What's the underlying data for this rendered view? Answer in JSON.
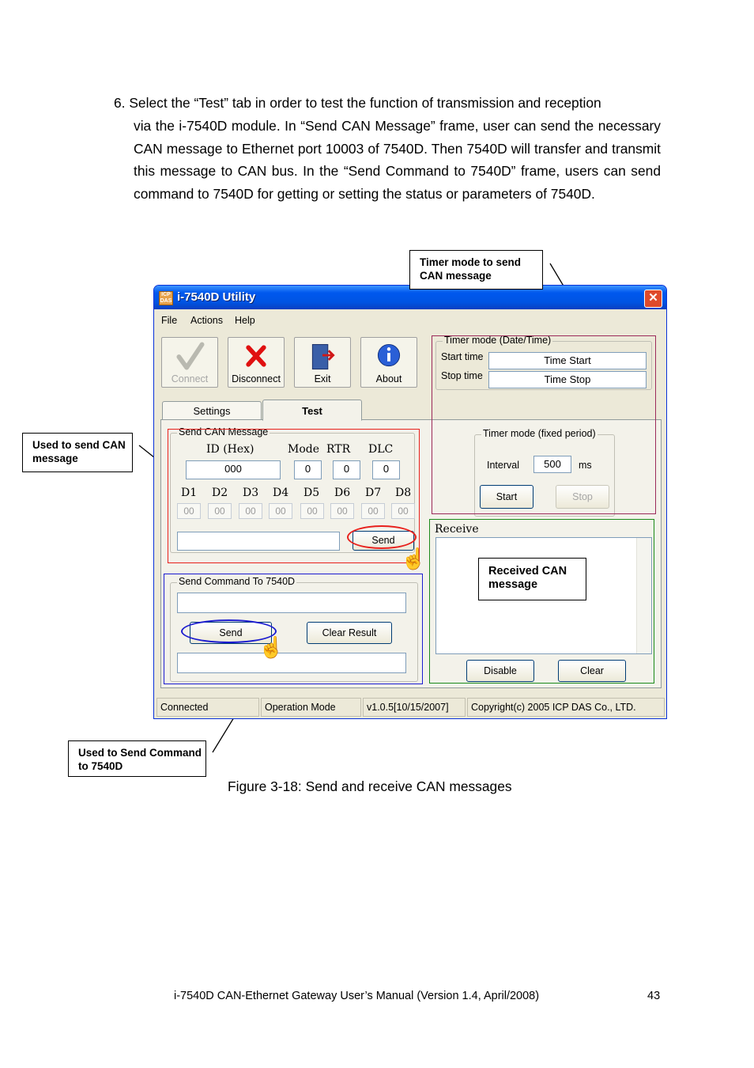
{
  "paragraph": {
    "first_line": "6. Select the “Test” tab in order to test the function of transmission and reception",
    "rest": "via the i-7540D module. In “Send CAN Message” frame, user can send the necessary CAN message to Ethernet port 10003 of 7540D. Then 7540D will transfer and transmit this message to CAN bus. In the “Send Command to 7540D” frame, users can send command to 7540D for getting or setting the status or parameters of 7540D."
  },
  "callouts": {
    "timer_mode": "Timer mode to send CAN message",
    "send_can": "Used to send CAN message",
    "received": "Received CAN message",
    "send_command": "Used to Send Command to 7540D"
  },
  "window": {
    "title": "i-7540D Utility",
    "icon_text": "ICP DAS",
    "close_glyph": "✕",
    "menu": [
      "File",
      "Actions",
      "Help"
    ],
    "toolbar": {
      "connect": "Connect",
      "disconnect": "Disconnect",
      "exit": "Exit",
      "about": "About"
    },
    "timer_datetime": {
      "label": "Timer mode  (Date/Time)",
      "start_label": "Start time",
      "start_value": "Time Start",
      "stop_label": "Stop time",
      "stop_value": "Time Stop"
    },
    "tabs": {
      "settings": "Settings",
      "test": "Test"
    },
    "send_can": {
      "label": "Send CAN Message",
      "id_label": "ID (Hex)",
      "mode_label": "Mode",
      "rtr_label": "RTR",
      "dlc_label": "DLC",
      "id_value": "000",
      "mode_value": "0",
      "rtr_value": "0",
      "dlc_value": "0",
      "data_labels": [
        "D1",
        "D2",
        "D3",
        "D4",
        "D5",
        "D6",
        "D7",
        "D8"
      ],
      "data_values": [
        "00",
        "00",
        "00",
        "00",
        "00",
        "00",
        "00",
        "00"
      ],
      "send_label": "Send"
    },
    "timer_fixed": {
      "label": "Timer mode (fixed period)",
      "interval_label": "Interval",
      "interval_value": "500",
      "unit": "ms",
      "start_label": "Start",
      "stop_label": "Stop"
    },
    "receive": {
      "label": "Receive",
      "disable_label": "Disable",
      "clear_label": "Clear"
    },
    "send_command": {
      "label": "Send Command To 7540D",
      "send_label": "Send",
      "clear_result_label": "Clear Result"
    },
    "status_bar": [
      "Connected",
      "Operation Mode",
      "v1.0.5[10/15/2007]",
      "Copyright(c) 2005 ICP DAS Co., LTD."
    ]
  },
  "caption": "Figure 3-18:  Send and receive CAN messages",
  "footer": "i-7540D CAN-Ethernet Gateway User’s Manual (Version 1.4, April/2008)",
  "page_number": "43",
  "colors": {
    "highlight_red": "#e8201c",
    "highlight_blue": "#1b1bd0",
    "highlight_green": "#1a8a1a",
    "highlight_purple": "#9c2a5a",
    "titlebar_blue": "#0054e3"
  }
}
